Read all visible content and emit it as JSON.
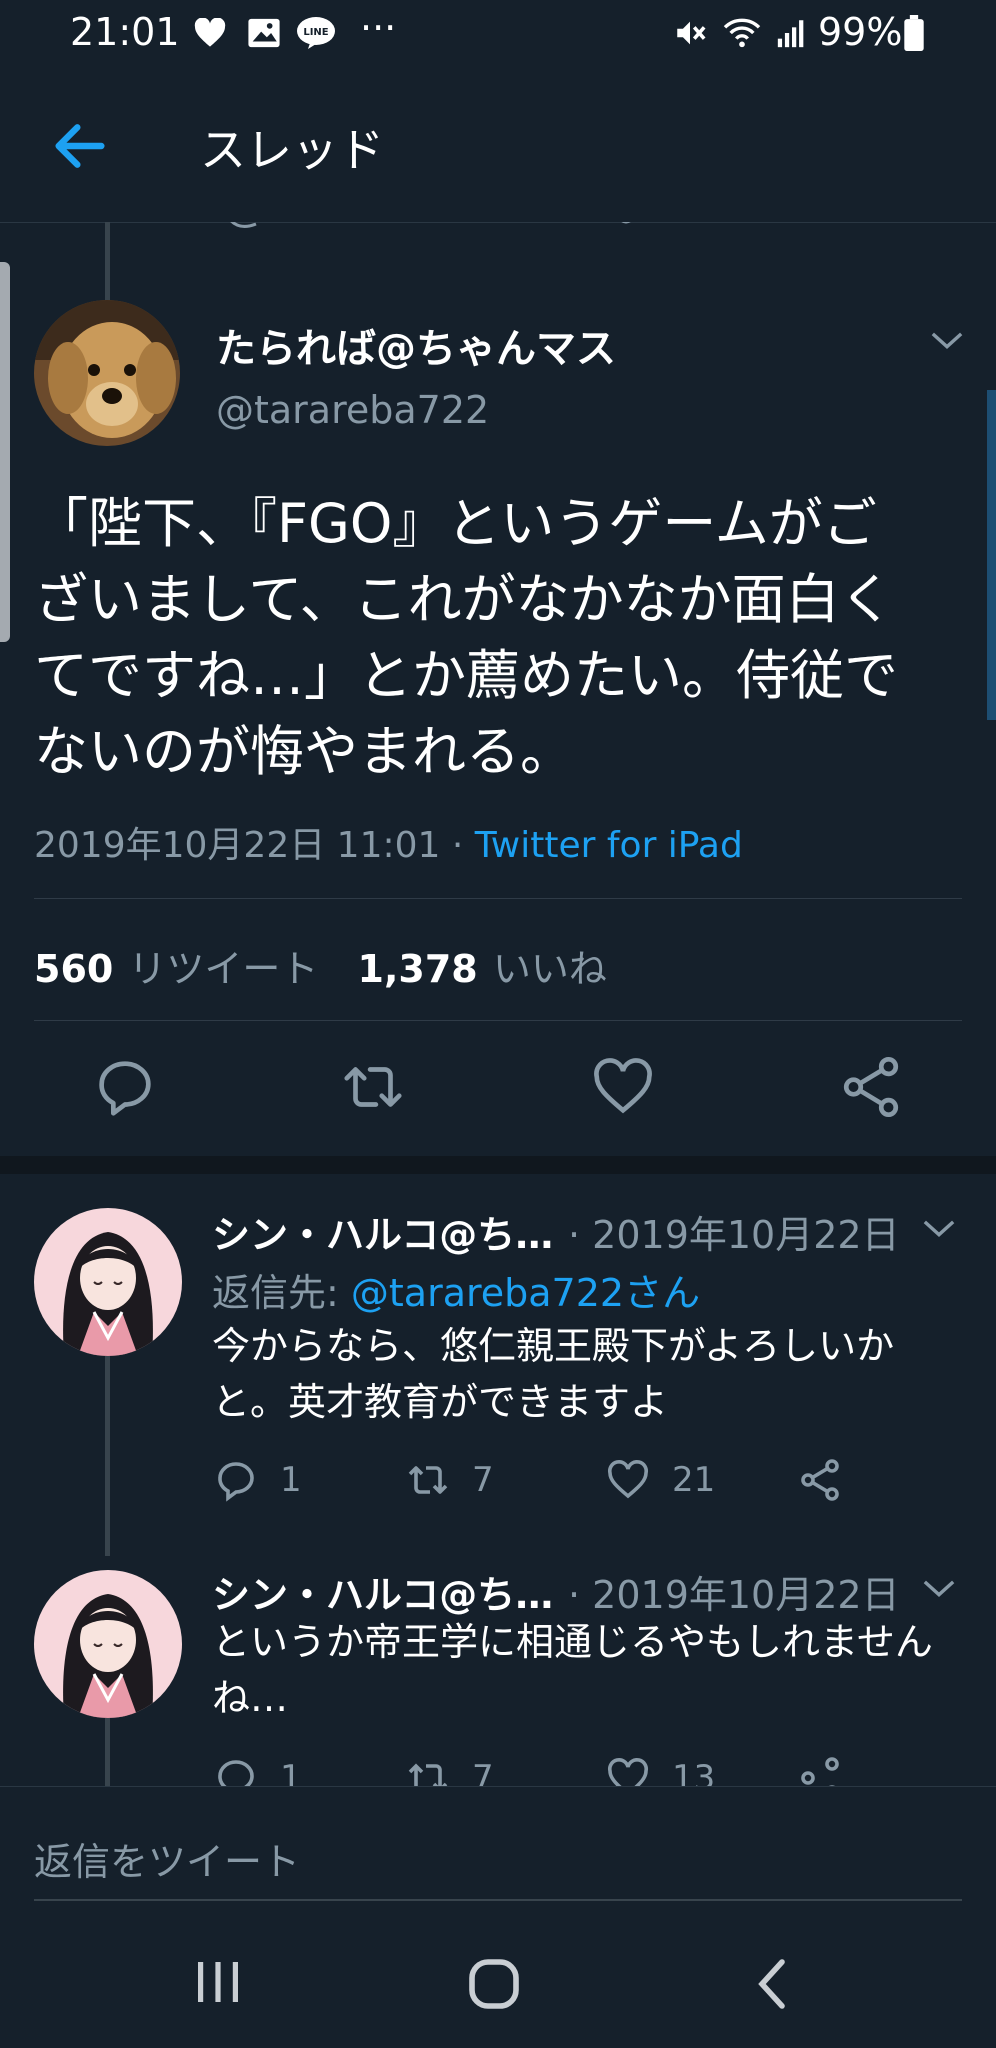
{
  "status_bar": {
    "time": "21:01",
    "dots": "···",
    "battery": "99%",
    "icons": [
      "heart-icon",
      "image-icon",
      "line-icon",
      "mute-icon",
      "wifi-icon",
      "signal-icon",
      "battery-icon"
    ]
  },
  "header": {
    "title": "スレッド",
    "back_icon": "arrow-left-icon"
  },
  "main_tweet": {
    "name": "たられば@ちゃんマス",
    "handle": "@tarareba722",
    "text_lines": [
      "「陛下、『FGO』というゲームがご",
      "ざいまして、これがなかなか面白く",
      "てですね…」とか薦めたい。侍従で",
      "ないのが悔やまれる。"
    ],
    "date": "2019年10月22日 11:01 · ",
    "client": "Twitter for iPad",
    "retweets": "560",
    "retweets_label": "リツイート",
    "likes": "1,378",
    "likes_label": "いいね"
  },
  "replies": [
    {
      "name": "シン・ハルコ@ち…",
      "date": "· 2019年10月22日",
      "reply_to_label": "返信先: ",
      "reply_to_handle": "@tarareba722さん",
      "text_lines": [
        "今からなら、悠仁親王殿下がよろしいか",
        "と。英才教育ができますよ"
      ],
      "reply_count": "1",
      "retweet_count": "7",
      "like_count": "21"
    },
    {
      "name": "シン・ハルコ@ち…",
      "date": "· 2019年10月22日",
      "text_lines": [
        "というか帝王学に相通じるやもしれません",
        "ね…"
      ],
      "reply_count": "1",
      "retweet_count": "7",
      "like_count": "13"
    }
  ],
  "composer": {
    "placeholder": "返信をツイート"
  },
  "colors": {
    "background": "#15202b",
    "accent": "#1da1f2",
    "muted": "#8899a6"
  }
}
